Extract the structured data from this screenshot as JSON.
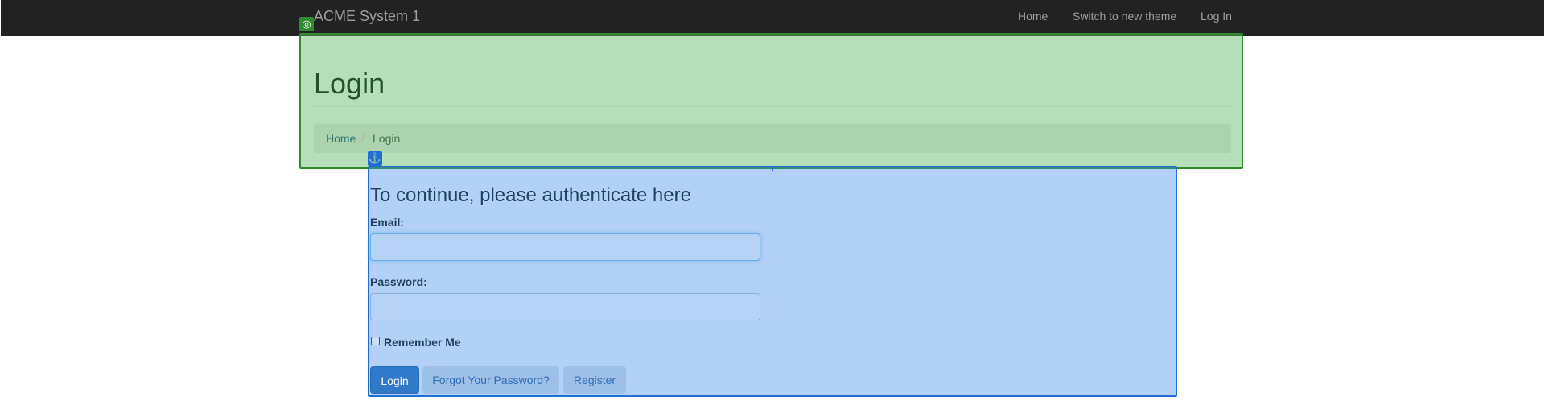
{
  "navbar": {
    "brand": "ACME System 1",
    "links": [
      {
        "label": "Home"
      },
      {
        "label": "Switch to new theme"
      },
      {
        "label": "Log In"
      }
    ]
  },
  "header": {
    "title": "Login",
    "breadcrumb": {
      "home": "Home",
      "separator": "/",
      "current": "Login"
    }
  },
  "form": {
    "heading": "To continue, please authenticate here",
    "email": {
      "label": "Email:",
      "value": ""
    },
    "password": {
      "label": "Password:",
      "value": ""
    },
    "remember": {
      "label": "Remember Me",
      "checked": false
    },
    "buttons": {
      "login": "Login",
      "forgot": "Forgot Your Password?",
      "register": "Register"
    }
  },
  "overlays": {
    "green_icon": "target-icon",
    "blue_icon": "anchor-icon",
    "green_color": "#2e8b2e",
    "blue_color": "#1e6fd0"
  }
}
